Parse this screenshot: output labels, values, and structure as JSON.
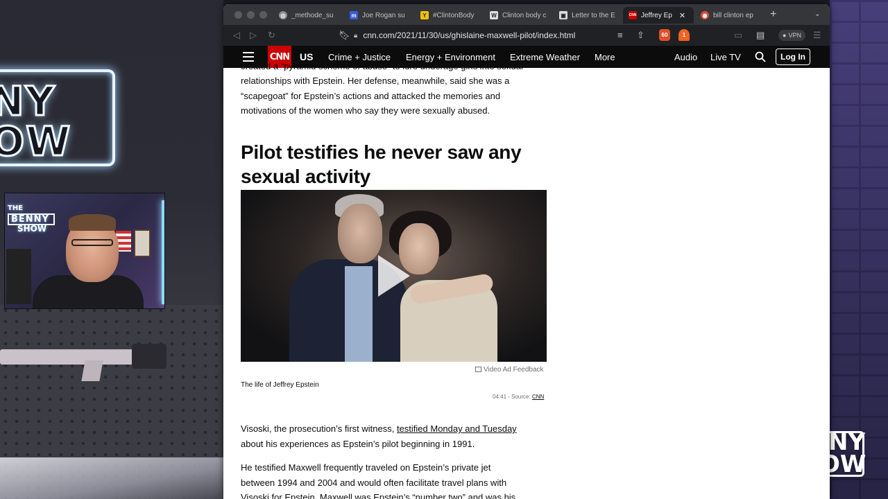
{
  "stream": {
    "neon_logo_lines": [
      "NY",
      "OW"
    ],
    "webcam_logo_top": "THE",
    "webcam_logo_main": "BENNY",
    "webcam_logo_bottom": "SHOW",
    "watermark_lines": [
      "NY",
      "OW"
    ]
  },
  "browser": {
    "tabs": [
      {
        "label": "_methode_su",
        "favicon": "globe-icon",
        "color": "#8a8d91",
        "active": false
      },
      {
        "label": "Joe Rogan su",
        "favicon": "m-icon",
        "color": "#3b5bd6",
        "active": false
      },
      {
        "label": "#ClintonBody",
        "favicon": "y-icon",
        "color": "#f2c200",
        "active": false
      },
      {
        "label": "Clinton body c",
        "favicon": "w-icon",
        "color": "#dddddd",
        "active": false
      },
      {
        "label": "Letter to the E",
        "favicon": "doc-icon",
        "color": "#dddddd",
        "active": false
      },
      {
        "label": "Jeffrey Ep",
        "favicon": "cnn-icon",
        "color": "#cc0000",
        "active": true
      },
      {
        "label": "bill clinton ep",
        "favicon": "target-icon",
        "color": "#e04a3a",
        "active": false
      }
    ],
    "new_tab_glyph": "+",
    "url": "cnn.com/2021/11/30/us/ghislaine-maxwell-pilot/index.html",
    "brave_badge": "60",
    "alert_badge": "1",
    "vpn_label": "VPN"
  },
  "site": {
    "logo": "CNN",
    "section": "US",
    "nav": [
      "Crime + Justice",
      "Energy + Environment",
      "Extreme Weather",
      "More"
    ],
    "right_nav": [
      "Audio",
      "Live TV"
    ],
    "login": "Log In"
  },
  "article": {
    "cut_top_line": "created a “pyramid scheme of abuse” to lure underage girls into sexual",
    "para1_lines": [
      "relationships with Epstein. Her defense, meanwhile, said she was a",
      "“scapegoat” for Epstein’s actions and attacked the memories and",
      "motivations of the women who say they were sexually abused."
    ],
    "headline_lines": [
      "Pilot testifies he never saw any",
      "sexual activity"
    ],
    "video_ad_feedback": "Video Ad Feedback",
    "video_caption": "The life of Jeffrey Epstein",
    "video_duration": "04:41",
    "video_source_label": " - Source: ",
    "video_source": "CNN",
    "para2_prefix": "Visoski, the prosecution’s first witness, ",
    "para2_link": "testified Monday and Tuesday",
    "para2_suffix": "about his experiences as Epstein’s pilot beginning in 1991.",
    "para3_lines": [
      "He testified Maxwell frequently traveled on Epstein’s private jet",
      "between 1994 and 2004 and would often facilitate travel plans with",
      "Visoski for Epstein. Maxwell was Epstein’s “number two” and was his"
    ]
  }
}
